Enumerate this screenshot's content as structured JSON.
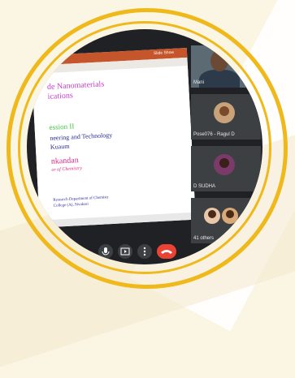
{
  "presentation": {
    "app_name": "Slide Show",
    "slide_lines": [
      "de Nanomaterials",
      "ications",
      "ession II",
      "neering and Technology",
      "Kuaum",
      "nkandan",
      "or of Chemistry",
      "Research Department of Chemistr",
      "College (A), Sivakasi"
    ]
  },
  "participants": [
    {
      "name": "Mani"
    },
    {
      "name": "Pose076 - Ragul D"
    },
    {
      "name": "D SUDHA"
    },
    {
      "name": "41 others"
    }
  ],
  "controls": {
    "mic_icon": "mic-icon",
    "present_icon": "present-icon",
    "more_icon": "more-options-icon",
    "hangup_icon": "hang-up-icon"
  },
  "colors": {
    "ring": "#efb91b",
    "background": "#fbf6e3",
    "meet_dark": "#202124",
    "hangup": "#ea4335"
  }
}
